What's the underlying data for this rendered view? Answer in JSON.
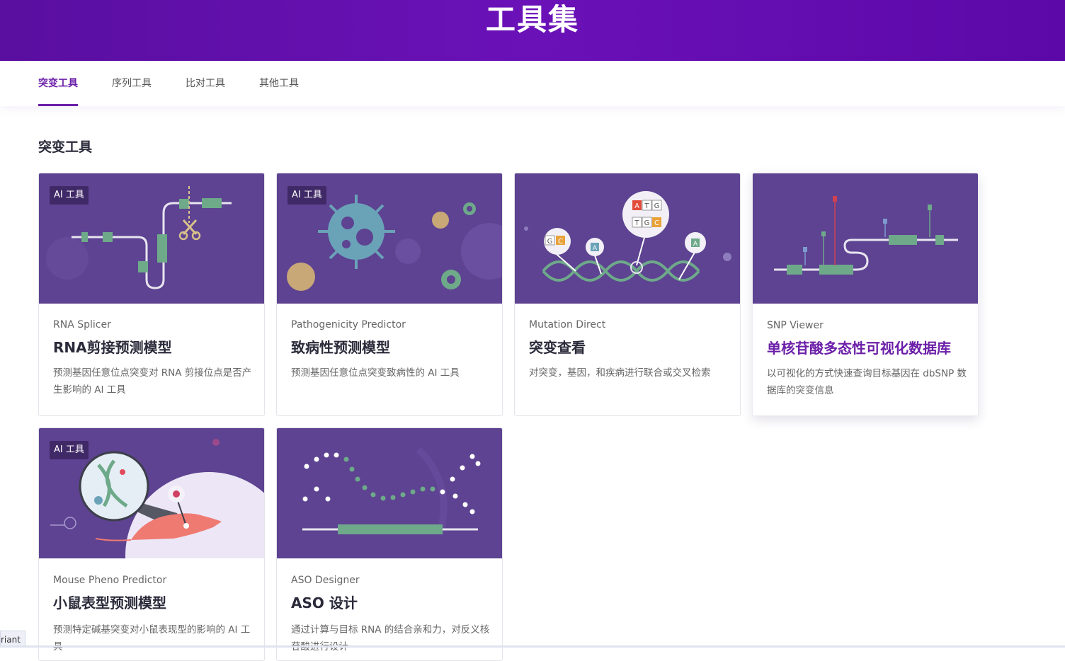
{
  "header": {
    "title": "工具集"
  },
  "tabs": [
    {
      "label": "突变工具",
      "active": true
    },
    {
      "label": "序列工具",
      "active": false
    },
    {
      "label": "比对工具",
      "active": false
    },
    {
      "label": "其他工具",
      "active": false
    }
  ],
  "section": {
    "title": "突变工具"
  },
  "badge_label": "AI 工具",
  "cards": [
    {
      "subtitle": "RNA Splicer",
      "title": "RNA剪接预测模型",
      "description": "预测基因任意位点突变对 RNA 剪接位点是否产生影响的 AI 工具",
      "badge": true
    },
    {
      "subtitle": "Pathogenicity Predictor",
      "title": "致病性预测模型",
      "description": "预测基因任意位点突变致病性的 AI 工具",
      "badge": true
    },
    {
      "subtitle": "Mutation Direct",
      "title": "突变查看",
      "description": "对突变，基因，和疾病进行联合或交叉检索",
      "badge": false
    },
    {
      "subtitle": "SNP Viewer",
      "title": "单核苷酸多态性可视化数据库",
      "description": "以可视化的方式快速查询目标基因在 dbSNP 数据库的突变信息",
      "badge": false
    },
    {
      "subtitle": "Mouse Pheno Predictor",
      "title": "小鼠表型预测模型",
      "description": "预测特定碱基突变对小鼠表现型的影响的 AI 工具",
      "badge": true
    },
    {
      "subtitle": "ASO Designer",
      "title": "ASO 设计",
      "description": "通过计算与目标 RNA 的结合亲和力，对反义核苷酸进行设计",
      "badge": false
    }
  ],
  "dna_letters": {
    "left": [
      "G",
      "C"
    ],
    "mid": "A",
    "top": [
      "A",
      "T",
      "G"
    ],
    "bottom": [
      "T",
      "G",
      "C"
    ],
    "right": "A"
  },
  "variant_tag": "riant",
  "colors": {
    "banner": "#6a11b8",
    "accent": "#6b1fa8",
    "card_image_bg": "#5d4391",
    "green": "#6ea98a"
  }
}
